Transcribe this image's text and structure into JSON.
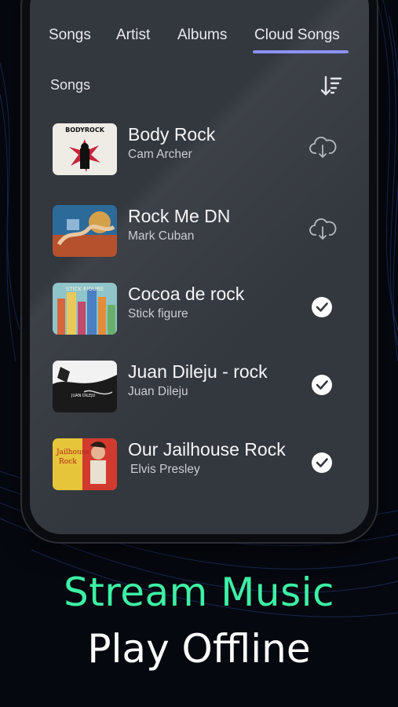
{
  "tabs": [
    {
      "label": "Songs",
      "active": false
    },
    {
      "label": "Artist",
      "active": false
    },
    {
      "label": "Albums",
      "active": false
    },
    {
      "label": "Cloud Songs",
      "active": true
    }
  ],
  "accent_color": "#8b93f5",
  "section_label": "Songs",
  "sort_icon": "sort-icon",
  "songs": [
    {
      "title": "Body Rock",
      "artist": "Cam Archer",
      "status": "cloud-download",
      "icon": "cloud-download-icon"
    },
    {
      "title": "Rock Me DN",
      "artist": "Mark Cuban",
      "status": "cloud-download",
      "icon": "cloud-download-icon"
    },
    {
      "title": "Cocoa de rock",
      "artist": "Stick figure",
      "status": "downloaded",
      "icon": "check-circle-icon"
    },
    {
      "title": "Juan Dileju - rock",
      "artist": "Juan Dileju",
      "status": "downloaded",
      "icon": "check-circle-icon"
    },
    {
      "title": "Our Jailhouse Rock",
      "artist": "Elvis Presley",
      "status": "downloaded",
      "icon": "check-circle-icon"
    }
  ],
  "tagline": {
    "line1": "Stream Music",
    "line2": "Play Offline",
    "line1_color": "#3df0a4",
    "line2_color": "#ffffff"
  }
}
